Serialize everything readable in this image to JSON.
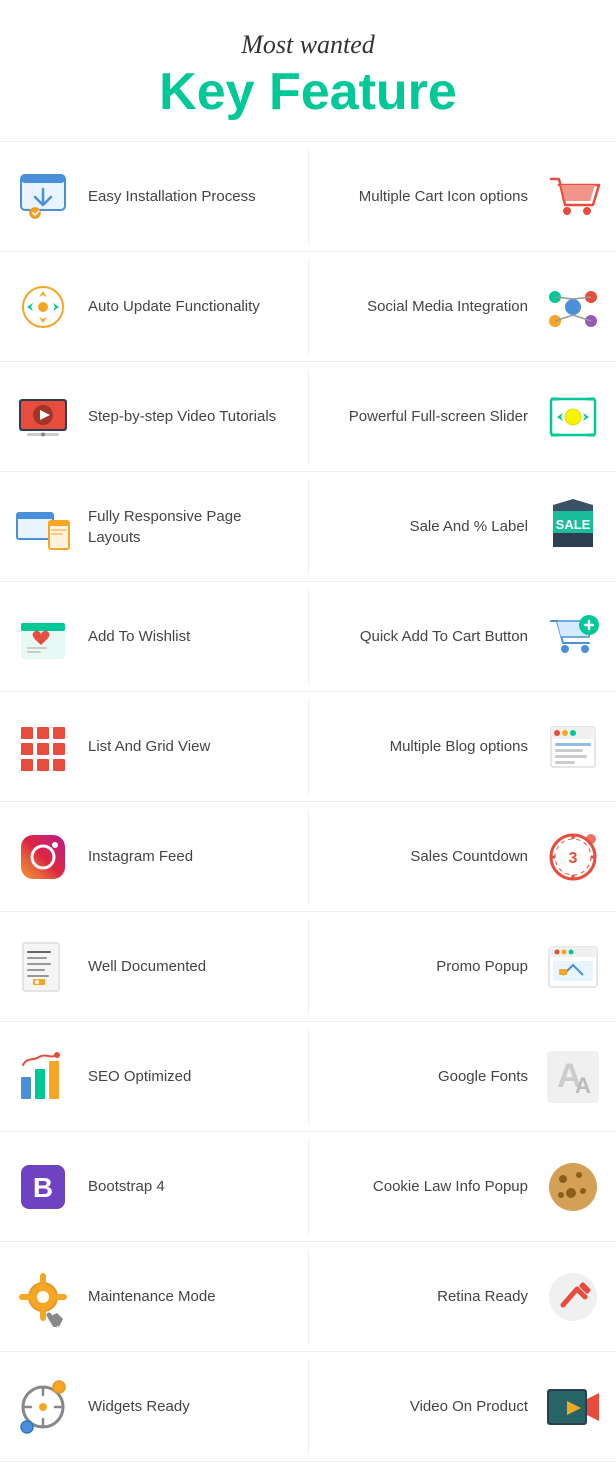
{
  "header": {
    "subtitle": "Most wanted",
    "title": "Key Feature"
  },
  "features": [
    {
      "left": {
        "label": "Easy Installation Process",
        "icon": "install"
      },
      "right": {
        "label": "Multiple Cart Icon options",
        "icon": "cart"
      }
    },
    {
      "left": {
        "label": "Auto Update Functionality",
        "icon": "update"
      },
      "right": {
        "label": "Social Media Integration",
        "icon": "social"
      }
    },
    {
      "left": {
        "label": "Step-by-step Video Tutorials",
        "icon": "video"
      },
      "right": {
        "label": "Powerful Full-screen Slider",
        "icon": "slider"
      }
    },
    {
      "left": {
        "label": "Fully Responsive Page Layouts",
        "icon": "responsive"
      },
      "right": {
        "label": "Sale And % Label",
        "icon": "sale"
      }
    },
    {
      "left": {
        "label": "Add To Wishlist",
        "icon": "wishlist"
      },
      "right": {
        "label": "Quick Add To Cart Button",
        "icon": "quickcart"
      }
    },
    {
      "left": {
        "label": "List And Grid View",
        "icon": "gridview"
      },
      "right": {
        "label": "Multiple Blog options",
        "icon": "blog"
      }
    },
    {
      "left": {
        "label": "Instagram Feed",
        "icon": "instagram"
      },
      "right": {
        "label": "Sales Countdown",
        "icon": "countdown"
      }
    },
    {
      "left": {
        "label": "Well Documented",
        "icon": "documented"
      },
      "right": {
        "label": "Promo Popup",
        "icon": "promo"
      }
    },
    {
      "left": {
        "label": "SEO Optimized",
        "icon": "seo"
      },
      "right": {
        "label": "Google Fonts",
        "icon": "fonts"
      }
    },
    {
      "left": {
        "label": "Bootstrap 4",
        "icon": "bootstrap"
      },
      "right": {
        "label": "Cookie Law Info Popup",
        "icon": "cookie"
      }
    },
    {
      "left": {
        "label": "Maintenance Mode",
        "icon": "maintenance"
      },
      "right": {
        "label": "Retina Ready",
        "icon": "retina"
      }
    },
    {
      "left": {
        "label": "Widgets Ready",
        "icon": "widgets"
      },
      "right": {
        "label": "Video On Product",
        "icon": "videoproduct"
      }
    }
  ]
}
